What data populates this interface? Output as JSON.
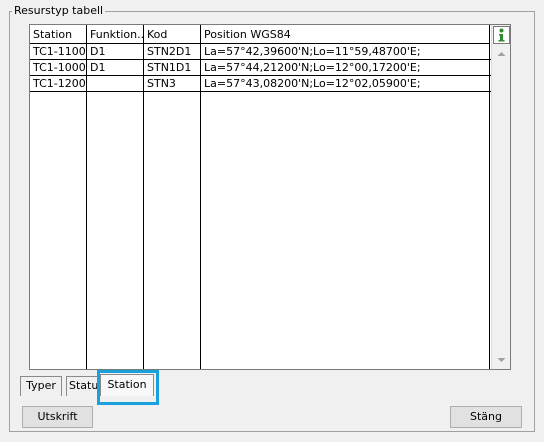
{
  "groupbox": {
    "title": "Resurstyp tabell"
  },
  "table": {
    "headers": [
      "Station",
      "Funktion...",
      "Kod",
      "Position WGS84"
    ],
    "rows": [
      [
        "TC1-1100",
        "D1",
        "STN2D1",
        "La=57°42,39600'N;Lo=11°59,48700'E;"
      ],
      [
        "TC1-1000",
        "D1",
        "STN1D1",
        "La=57°44,21200'N;Lo=12°00,17200'E;"
      ],
      [
        "TC1-1200",
        "",
        "STN3",
        "La=57°43,08200'N;Lo=12°02,05900'E;"
      ]
    ]
  },
  "icons": {
    "info": "info-icon",
    "scroll_up": "scroll-up-arrow-icon",
    "scroll_down": "scroll-down-arrow-icon"
  },
  "colors": {
    "highlight": "#1aa0dc",
    "info_icon": "#2e8b2e"
  },
  "tabs": [
    "Typer",
    "Status",
    "Station"
  ],
  "active_tab": "Station",
  "buttons": {
    "print_label": "Utskrift",
    "close_label": "Stäng"
  }
}
